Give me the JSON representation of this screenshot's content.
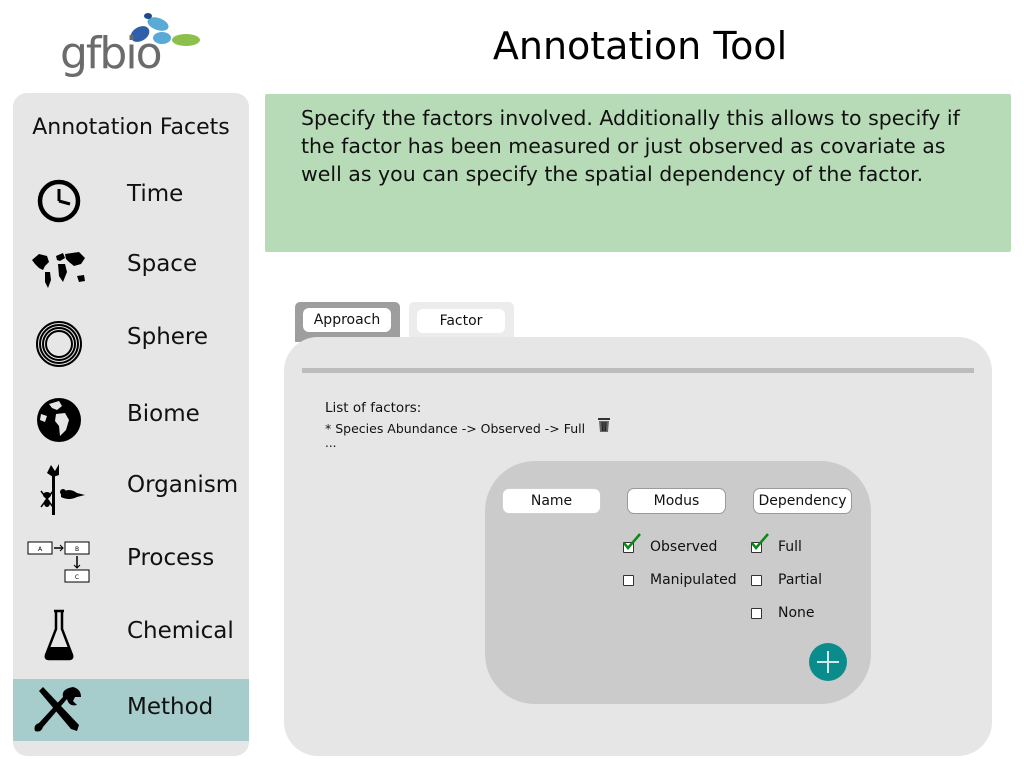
{
  "header": {
    "logo_text": "gfbio",
    "title": "Annotation Tool"
  },
  "sidebar": {
    "title": "Annotation Facets",
    "items": [
      {
        "label": "Time",
        "icon": "clock-icon"
      },
      {
        "label": "Space",
        "icon": "world-map-icon"
      },
      {
        "label": "Sphere",
        "icon": "concentric-circles-icon"
      },
      {
        "label": "Biome",
        "icon": "globe-icon"
      },
      {
        "label": "Organism",
        "icon": "organisms-icon"
      },
      {
        "label": "Process",
        "icon": "process-diagram-icon",
        "box_labels": [
          "A",
          "B",
          "C"
        ]
      },
      {
        "label": "Chemical",
        "icon": "flask-icon"
      },
      {
        "label": "Method",
        "icon": "tools-icon",
        "active": true
      }
    ]
  },
  "info": {
    "text": "Specify the factors involved. Additionally this allows to specify if the factor has been measured or just observed as covariate as well as you can specify the spatial dependency of the factor."
  },
  "tabs": [
    {
      "label": "Approach"
    },
    {
      "label": "Factor"
    }
  ],
  "panel": {
    "list_heading": "List of factors:",
    "factor_item": "* Species Abundance -> Observed -> Full",
    "ellipsis": "...",
    "form": {
      "columns": [
        "Name",
        "Modus",
        "Dependency"
      ],
      "modus_options": [
        {
          "label": "Observed",
          "checked": true
        },
        {
          "label": "Manipulated",
          "checked": false
        }
      ],
      "dependency_options": [
        {
          "label": "Full",
          "checked": true
        },
        {
          "label": "Partial",
          "checked": false
        },
        {
          "label": "None",
          "checked": false
        }
      ]
    }
  },
  "colors": {
    "info_bg": "#b6dbb6",
    "sidebar_bg": "#e6e6e6",
    "active_facet": "#a7cccc",
    "add_button": "#0b8c8c",
    "check_green": "#0a8a14"
  }
}
